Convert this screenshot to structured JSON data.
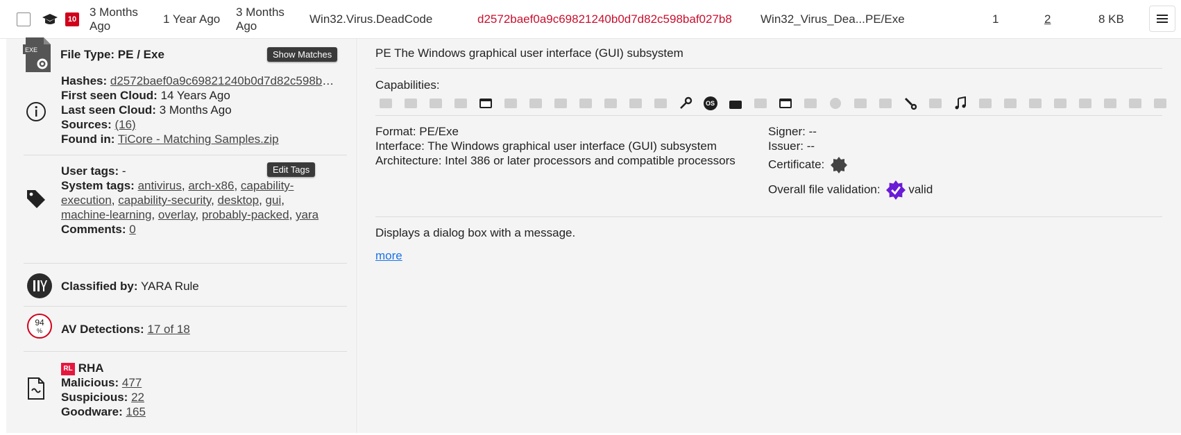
{
  "row": {
    "threat_level": "10",
    "first_seen": "3 Months Ago",
    "last_seen": "1 Year Ago",
    "first_seen_cloud": "3 Months Ago",
    "threat_name": "Win32.Virus.DeadCode",
    "hash": "d2572baef0a9c69821240b0d7d82c598baf027b8",
    "file_name": "Win32_Virus_Dea...",
    "file_type": "PE/Exe",
    "count1": "1",
    "count2": "2",
    "size": "8 KB"
  },
  "left": {
    "file_type_label": "File Type: PE / Exe",
    "file_icon_text": "EXE",
    "show_matches": "Show Matches",
    "hashes_label": "Hashes:",
    "hashes_value": "d2572baef0a9c69821240b0d7d82c598baf027b8",
    "first_seen_cloud_label": "First seen Cloud:",
    "first_seen_cloud_value": "14 Years Ago",
    "last_seen_cloud_label": "Last seen Cloud:",
    "last_seen_cloud_value": "3 Months Ago",
    "sources_label": "Sources:",
    "sources_value": "(16)",
    "found_in_label": "Found in:",
    "found_in_value": "TiCore - Matching Samples.zip",
    "user_tags_label": "User tags:",
    "user_tags_value": "-",
    "edit_tags": "Edit Tags",
    "system_tags_label": "System tags:",
    "system_tags": [
      "antivirus",
      "arch-x86",
      "capability-execution",
      "capability-security",
      "desktop",
      "gui",
      "machine-learning",
      "overlay",
      "probably-packed",
      "yara"
    ],
    "comments_label": "Comments:",
    "comments_value": "0",
    "classified_label": "Classified by:",
    "classified_value": "YARA Rule",
    "av_label": "AV Detections:",
    "av_value": "17 of 18",
    "av_percent": "94",
    "av_percent_sign": "%",
    "rha_badge": "RL",
    "rha_title": "RHA",
    "malicious_label": "Malicious:",
    "malicious_value": "477",
    "suspicious_label": "Suspicious:",
    "suspicious_value": "22",
    "goodware_label": "Goodware:",
    "goodware_value": "165"
  },
  "right": {
    "title": "PE The Windows graphical user interface (GUI) subsystem",
    "capabilities_label": "Capabilities:",
    "format_line": "Format: PE/Exe",
    "interface_line": "Interface: The Windows graphical user interface (GUI) subsystem",
    "architecture_line": "Architecture: Intel 386 or later processors and compatible processors",
    "signer_line": "Signer: --",
    "issuer_line": "Issuer: --",
    "certificate_label": "Certificate:",
    "validation_label": "Overall file validation:",
    "validation_value": "valid",
    "description": "Displays a dialog box with a message.",
    "more": "more",
    "os_badge": "OS"
  },
  "colors": {
    "threat_red": "#c8102e",
    "badge_red": "#d0021b",
    "valid_purple": "#6a1bd6",
    "link_blue": "#1a73e8"
  }
}
